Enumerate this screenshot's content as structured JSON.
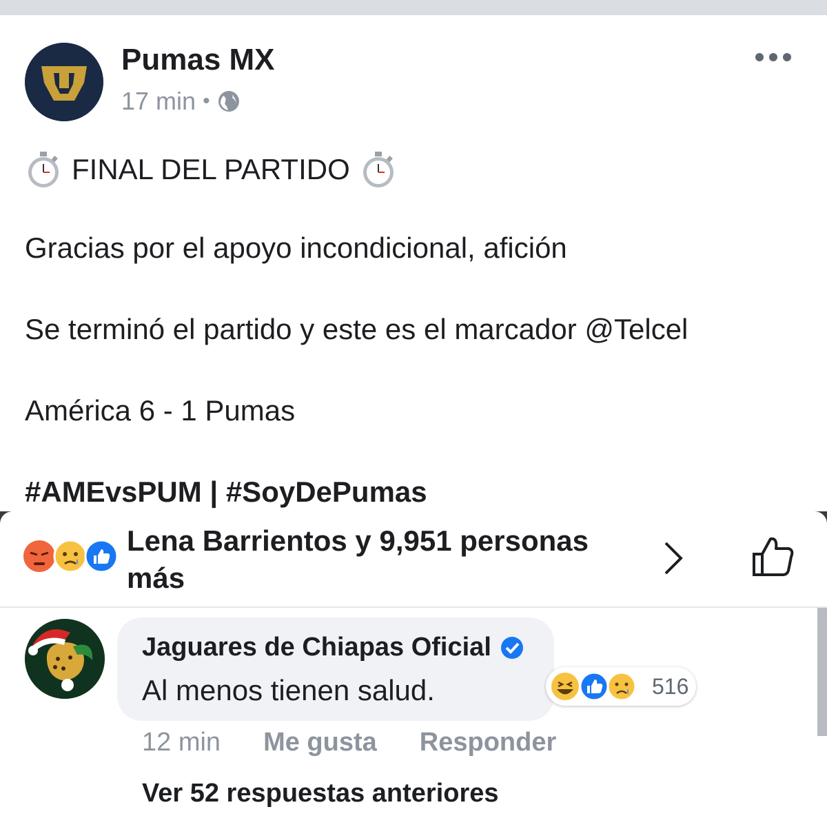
{
  "post": {
    "page_name": "Pumas MX",
    "time": "17 min",
    "separator": "•",
    "privacy_icon": "globe-icon",
    "lines": [
      "FINAL DEL PARTIDO",
      "Gracias por el apoyo incondicional, afición",
      "Se terminó el partido y este es el marcador @Telcel",
      "América 6 - 1 Pumas",
      "#AMEvsPUM | #SoyDePumas"
    ]
  },
  "reactions": {
    "icons": [
      "angry-reaction-icon",
      "sad-reaction-icon",
      "like-reaction-icon"
    ],
    "summary": "Lena Barrientos y 9,951 personas más"
  },
  "comment": {
    "author": "Jaguares de Chiapas Oficial",
    "text": "Al menos tienen salud.",
    "reaction_icons": [
      "haha-reaction-icon",
      "like-reaction-icon",
      "sad-reaction-icon"
    ],
    "reaction_count": "516",
    "time": "12 min",
    "like_label": "Me gusta",
    "reply_label": "Responder"
  },
  "replies_link": "Ver 52 respuestas anteriores",
  "colors": {
    "facebook_blue": "#1877f2",
    "angry": "#f0653b",
    "emoji_yellow": "#f7c242",
    "pumas_gold": "#c9a13a",
    "pumas_navy": "#1a2a45",
    "jaguares_green": "#10331f",
    "secondary_text": "#8d949e"
  }
}
